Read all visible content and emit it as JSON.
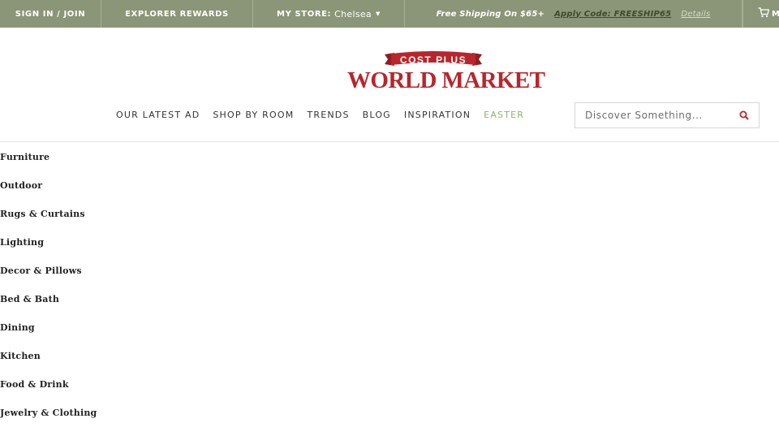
{
  "topbar": {
    "sign_in": "SIGN IN / JOIN",
    "rewards": "EXPLORER REWARDS",
    "store_label": "MY STORE:",
    "store_name": "Chelsea",
    "promo_text": "Free Shipping On $65+",
    "promo_code": "Apply Code: FREESHIP65",
    "promo_details": "Details",
    "cart_label": "M"
  },
  "logo": {
    "banner": "COST PLUS",
    "wordmark": "WORLD MARKET"
  },
  "nav": {
    "items": [
      "OUR LATEST AD",
      "SHOP BY ROOM",
      "TRENDS",
      "BLOG",
      "INSPIRATION",
      "EASTER"
    ]
  },
  "search": {
    "placeholder": "Discover Something..."
  },
  "categories": [
    "Furniture",
    "Outdoor",
    "Rugs & Curtains",
    "Lighting",
    "Decor & Pillows",
    "Bed & Bath",
    "Dining",
    "Kitchen",
    "Food & Drink",
    "Jewelry & Clothing"
  ],
  "colors": {
    "topbar_bg": "#8a9677",
    "brand_red": "#b8262b",
    "nav_accent": "#8fb36a"
  },
  "icons": {
    "cart": "cart-icon",
    "search": "search-icon",
    "caret": "caret-down-icon"
  }
}
